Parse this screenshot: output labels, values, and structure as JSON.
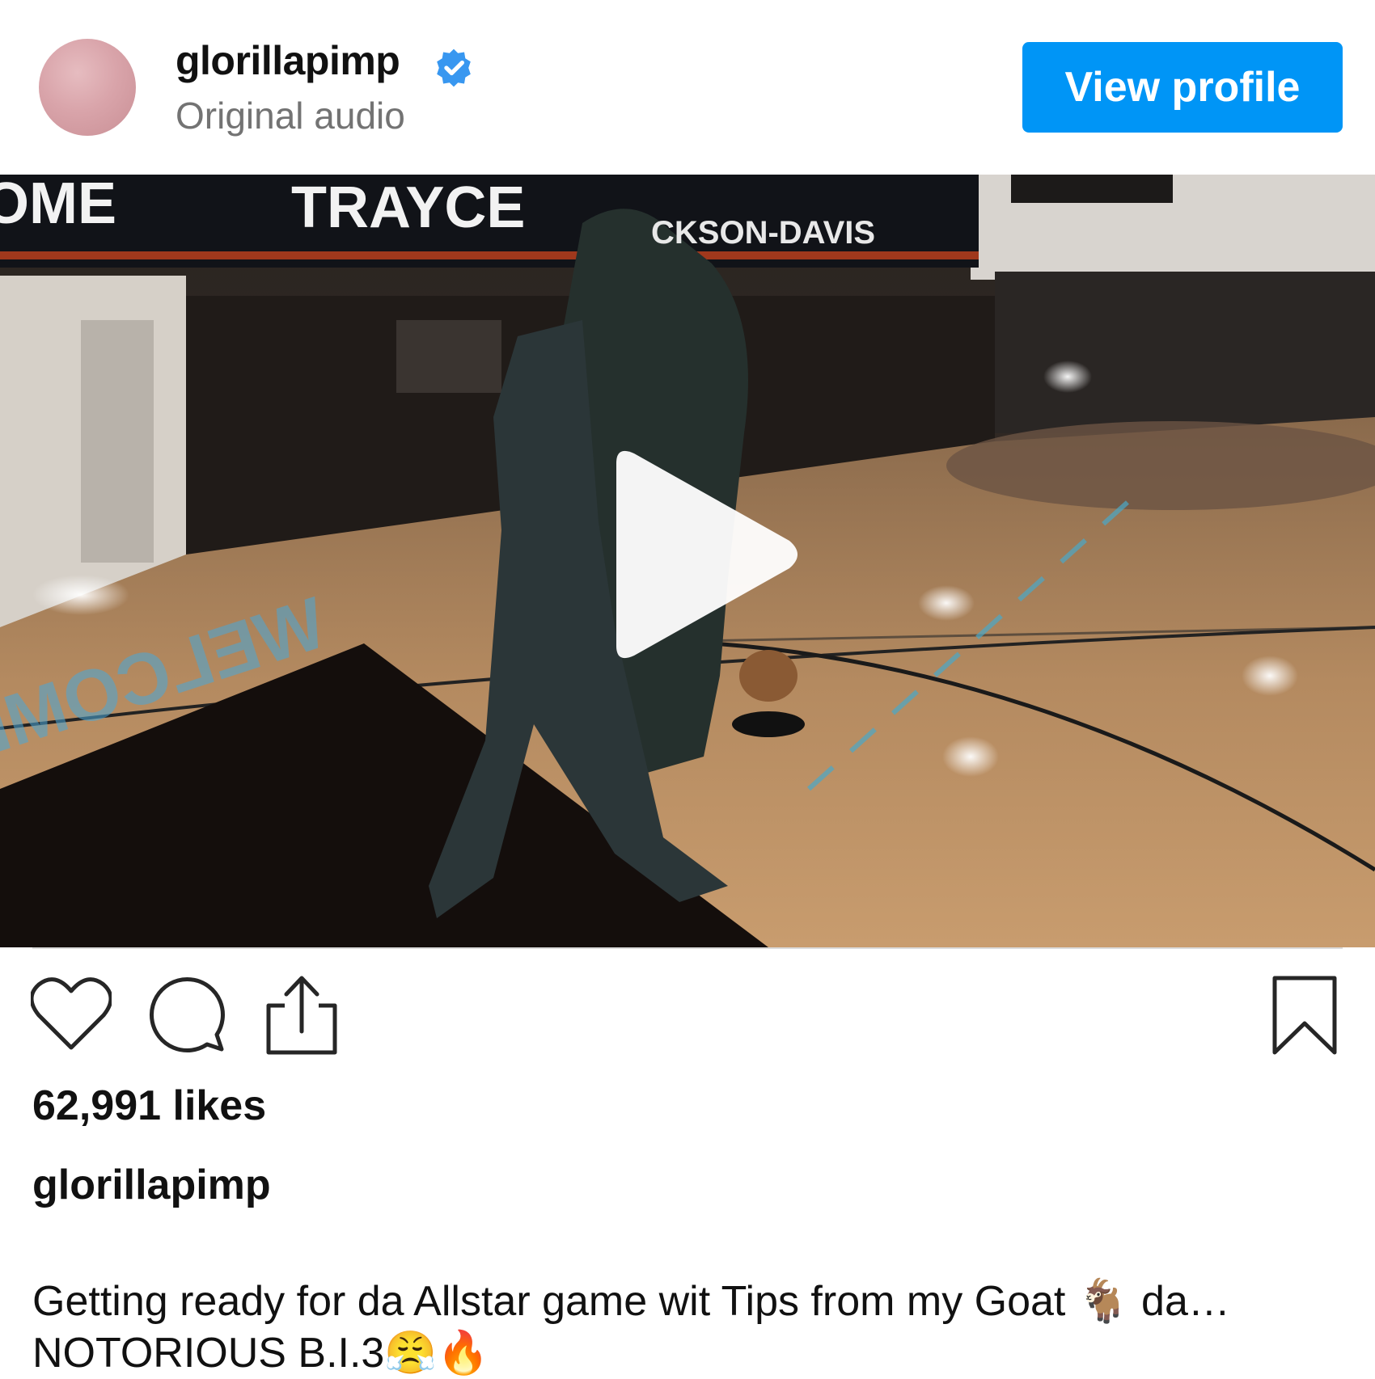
{
  "header": {
    "username": "glorillapimp",
    "subtitle": "Original audio",
    "view_profile_label": "View profile"
  },
  "video": {
    "scoreboard_left_text": "OME",
    "scoreboard_text": "TRAYCE",
    "scoreboard_text_2": "CKSON-DAVIS",
    "floor_text": "WELCOME"
  },
  "post": {
    "likes": "62,991 likes",
    "caption_username": "glorillapimp",
    "caption_line1": "Getting ready for da Allstar game wit Tips from my Goat 🐐 da…",
    "caption_line2": "NOTORIOUS B.I.3😤🔥"
  },
  "colors": {
    "accent": "#0095f6",
    "verified": "#3897f0"
  },
  "icons": [
    "verified-badge-icon",
    "play-icon",
    "heart-icon",
    "comment-icon",
    "share-icon",
    "bookmark-icon"
  ]
}
